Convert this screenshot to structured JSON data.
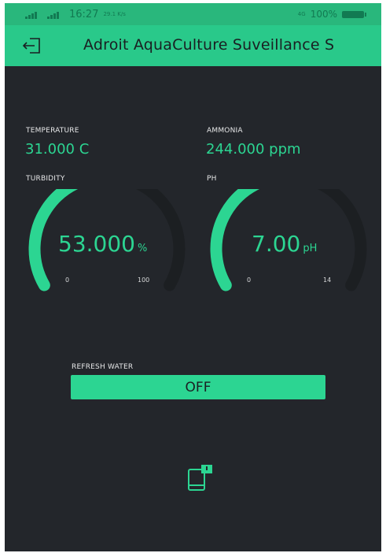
{
  "status_bar": {
    "network_left": "4G 4G",
    "time": "16:27",
    "data_rate": "29.1 K/s",
    "right_network": "4G",
    "battery": "100%"
  },
  "app_bar": {
    "title": "Adroit AquaCulture Suveillance S",
    "logout_icon": "logout-icon"
  },
  "sensors": {
    "temperature": {
      "label": "TEMPERATURE",
      "value": "31.000 C"
    },
    "ammonia": {
      "label": "AMMONIA",
      "value": "244.000 ppm"
    }
  },
  "gauges": {
    "turbidity": {
      "label": "TURBIDITY",
      "value": "53.000",
      "unit": "%",
      "min": "0",
      "max": "100",
      "fraction": 0.53
    },
    "ph": {
      "label": "PH",
      "value": "7.00",
      "unit": "pH",
      "min": "0",
      "max": "14",
      "fraction": 0.5
    }
  },
  "refresh_water": {
    "label": "REFRESH WATER",
    "button_label": "OFF"
  },
  "colors": {
    "accent": "#2cd592",
    "app_bar": "#29c98a",
    "background": "#23262b",
    "gauge_track": "#1c1f22"
  },
  "icons": {
    "notification": "tablet-notification-icon"
  }
}
